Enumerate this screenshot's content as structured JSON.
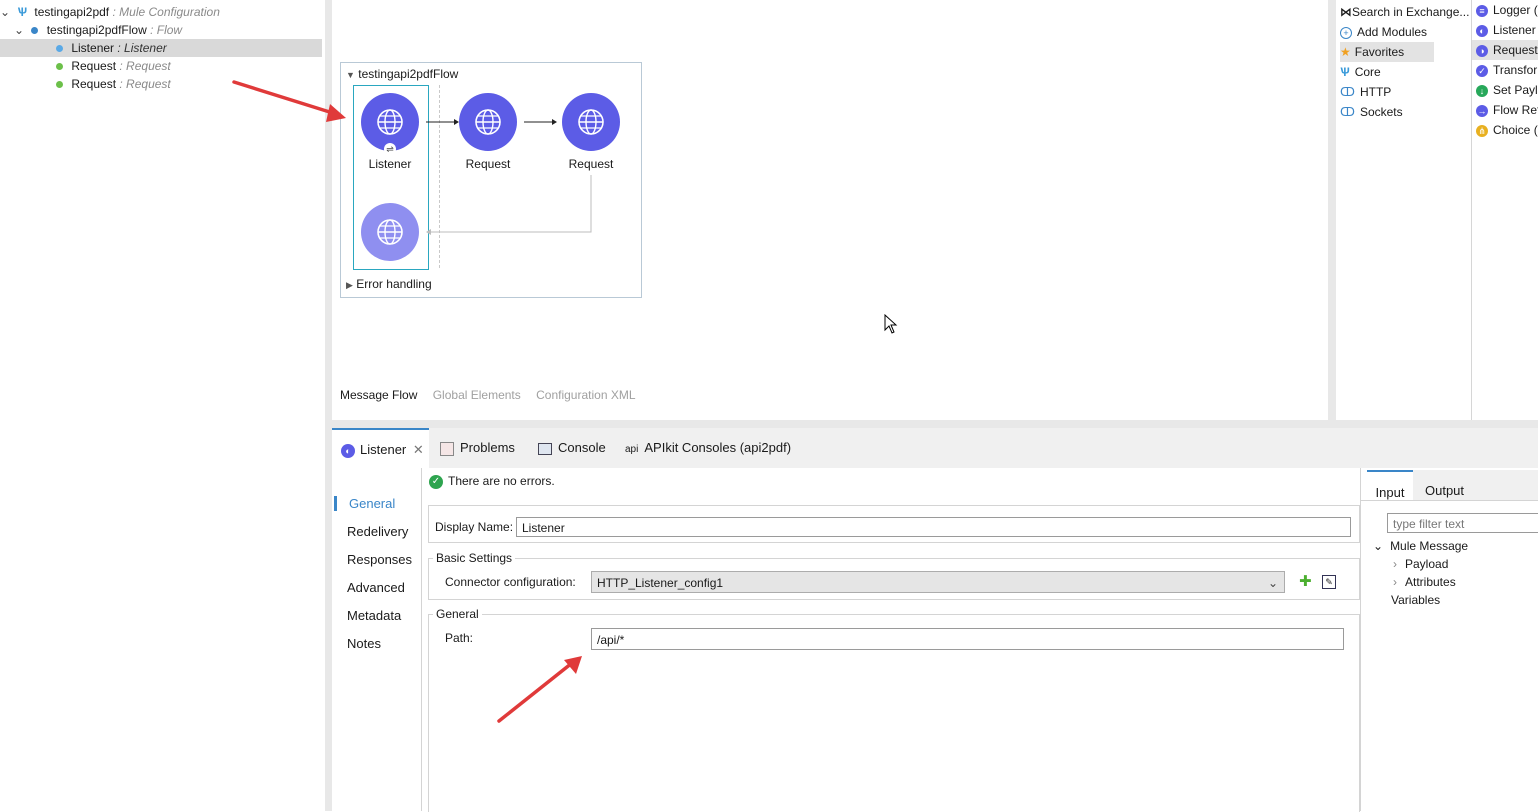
{
  "outline": {
    "root": {
      "name": "testingapi2pdf",
      "type": " : Mule Configuration"
    },
    "flow": {
      "name": "testingapi2pdfFlow",
      "type": " : Flow"
    },
    "items": [
      {
        "name": "Listener",
        "type": " : Listener"
      },
      {
        "name": "Request",
        "type": " : Request"
      },
      {
        "name": "Request",
        "type": " : Request"
      }
    ]
  },
  "canvas": {
    "flow_name": "testingapi2pdfFlow",
    "nodes": [
      {
        "label": "Listener"
      },
      {
        "label": "Request"
      },
      {
        "label": "Request"
      }
    ],
    "error_handling": "Error handling",
    "bottom_tabs": [
      "Message Flow",
      "Global Elements",
      "Configuration XML"
    ]
  },
  "palette": {
    "categories": [
      "Search in Exchange...",
      "Add Modules",
      "Favorites",
      "Core",
      "HTTP",
      "Sockets"
    ],
    "operations": [
      "Logger (",
      "Listener",
      "Request",
      "Transforr",
      "Set Paylo",
      "Flow Ref",
      "Choice ("
    ]
  },
  "tabs": {
    "listener": "Listener",
    "problems": "Problems",
    "console": "Console",
    "apikit": "APIkit Consoles (api2pdf)",
    "apikit_prefix": "api"
  },
  "props": {
    "status": "There are no errors.",
    "nav": [
      "General",
      "Redelivery",
      "Responses",
      "Advanced",
      "Metadata",
      "Notes"
    ],
    "display_name_label": "Display Name:",
    "display_name_value": "Listener",
    "basic_settings": "Basic Settings",
    "connector_label": "Connector configuration:",
    "connector_value": "HTTP_Listener_config1",
    "general_group": "General",
    "path_label": "Path:",
    "path_value": "/api/*"
  },
  "metadata": {
    "tabs": [
      "Input",
      "Output"
    ],
    "filter_placeholder": "type filter text",
    "tree": [
      "Mule Message",
      "Payload",
      "Attributes",
      "Variables"
    ]
  },
  "colors": {
    "node": "#5c5ce6",
    "accent": "#3a86c8",
    "annotation": "#e03a3a"
  }
}
